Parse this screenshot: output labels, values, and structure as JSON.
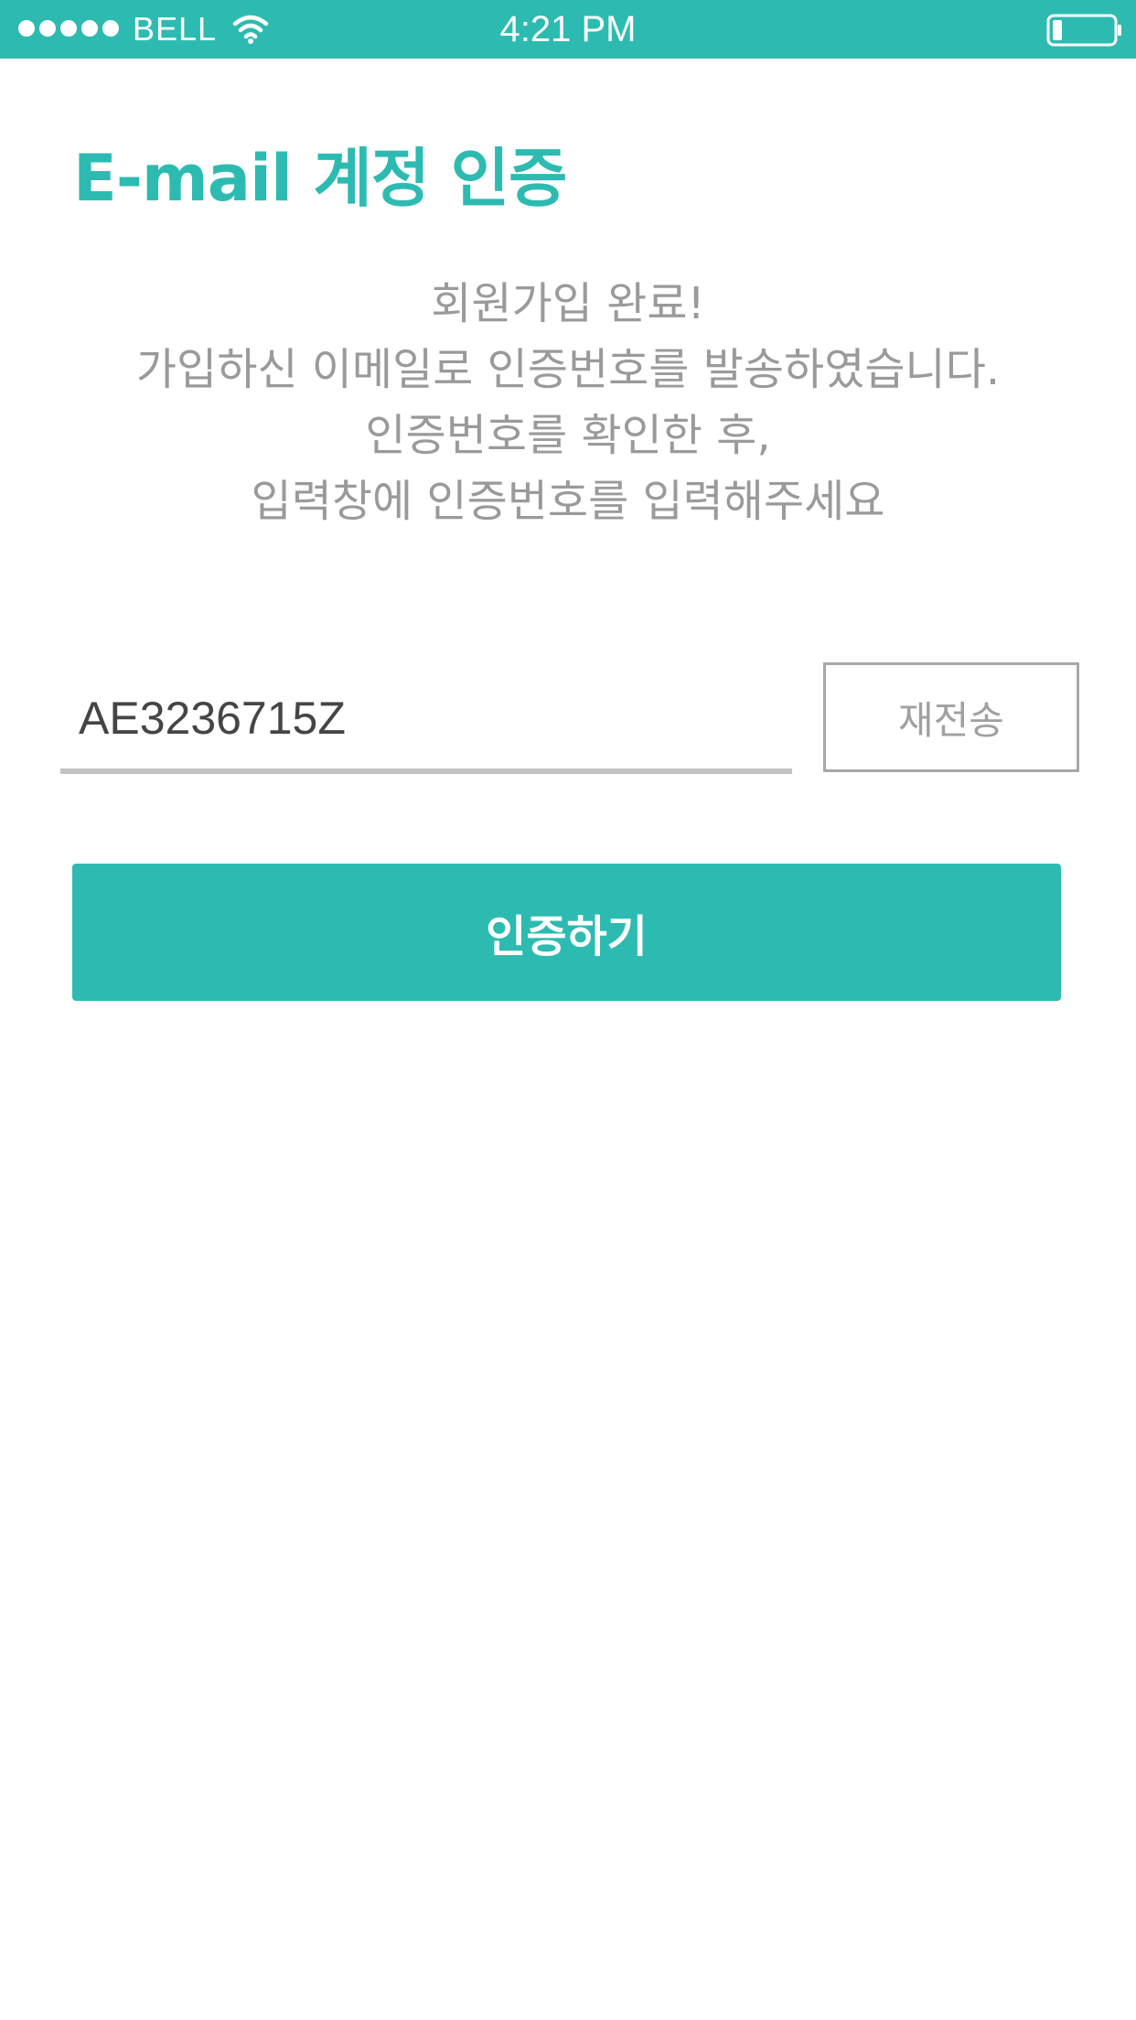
{
  "status_bar": {
    "carrier": "BELL",
    "time": "4:21 PM",
    "signal_icon": "signal-dots-icon",
    "wifi_icon": "wifi-icon",
    "battery_icon": "battery-icon",
    "battery_level": 0.15,
    "background_color": "#2dbbb1"
  },
  "page": {
    "title": "E-mail 계정 인증",
    "accent_color": "#2dbbb1"
  },
  "message": {
    "line1": "회원가입 완료!",
    "line2": "가입하신 이메일로 인증번호를 발송하였습니다.",
    "line3": "인증번호를 확인한 후,",
    "line4": "입력창에 인증번호를 입력해주세요"
  },
  "code_input": {
    "value": "AE3236715Z",
    "placeholder": ""
  },
  "resend_button": {
    "label": "재전송"
  },
  "verify_button": {
    "label": "인증하기"
  }
}
